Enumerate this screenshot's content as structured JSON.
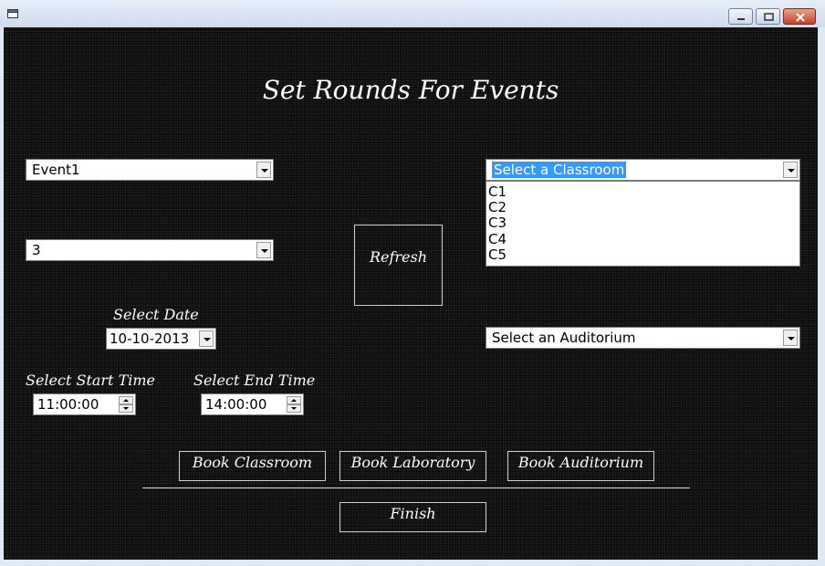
{
  "window": {
    "minimize_icon": "minimize-icon",
    "maximize_icon": "maximize-icon",
    "close_icon": "close-icon"
  },
  "heading": "Set Rounds For Events",
  "event_combo": {
    "value": "Event1"
  },
  "rounds_combo": {
    "value": "3"
  },
  "classroom_combo": {
    "value": "Select a Classroom",
    "options": [
      "C1",
      "C2",
      "C3",
      "C4",
      "C5"
    ]
  },
  "refresh_label": "Refresh",
  "date": {
    "label": "Select Date",
    "value": "10-10-2013"
  },
  "auditorium_combo": {
    "value": "Select an Auditorium"
  },
  "start_time": {
    "label": "Select Start Time",
    "value": "11:00:00"
  },
  "end_time": {
    "label": "Select End Time",
    "value": "14:00:00"
  },
  "buttons": {
    "book_classroom": "Book Classroom",
    "book_laboratory": "Book Laboratory",
    "book_auditorium": "Book Auditorium",
    "finish": "Finish"
  }
}
